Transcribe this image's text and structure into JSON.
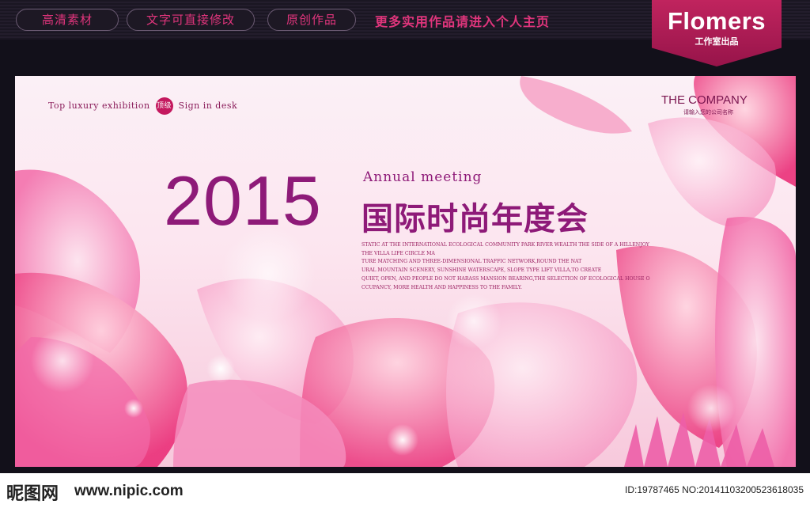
{
  "topbar": {
    "pills": [
      "高清素材",
      "文字可直接修改",
      "原创作品"
    ],
    "link": "更多实用作品请进入个人主页"
  },
  "brand": {
    "name": "Flomers",
    "sub": "工作室出品"
  },
  "banner": {
    "tag_left": "Top luxury exhibition",
    "tag_badge": "顶级",
    "tag_right": "Sign in desk",
    "company": "THE COMPANY",
    "company_sub": "请输入您的公司名称",
    "year": "2015",
    "annual": "Annual meeting",
    "title": "国际时尚年度会",
    "description": [
      "STATIC AT THE INTERNATIONAL ECOLOGICAL COMMUNITY PARK RIVER WEALTH THE SIDE OF A HILLENJOY",
      "THE VILLA LIFE CIRCLE MA",
      "TURE MATCHING AND THREE-DIMENSIONAL TRAFFIC NETWORK,ROUND THE NAT",
      "URAL MOUNTAIN SCENERY, SUNSHINE WATERSCAPE, SLOPE TYPE LIFT VILLA,TO CREATE",
      "QUIET, OPEN, AND PEOPLE DO NOT HARASS MANSION BEARING,THE SELECTION OF ECOLOGICAL HOUSE O",
      "CCUPANCY, MORE HEALTH AND HAPPINESS TO THE FAMILY."
    ],
    "colors": {
      "accent": "#8e1a78",
      "petal": "#f06aa6"
    }
  },
  "footer": {
    "logo": "昵图网",
    "site": "www.nipic.com",
    "image_id": "ID:19787465 NO:20141103200523618035"
  }
}
